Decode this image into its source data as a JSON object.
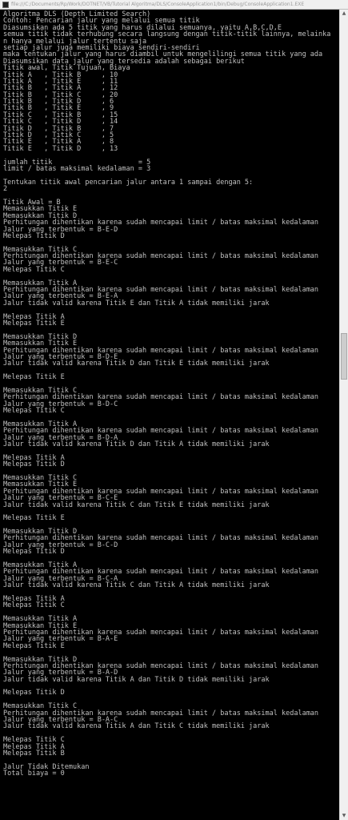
{
  "window": {
    "title": "file:///C:/Documents/Rp/Work/DOTNET/VB/Tutorial Algoritma/DLS/ConsoleApplication1/bin/Debug/ConsoleApplication1.EXE"
  },
  "scrollbar": {
    "up_icon": "▲",
    "down_icon": "▼"
  },
  "console": {
    "lines": [
      "Algoritma DLS (Depth Limited Search)",
      "Contoh: Pencarian jalur yang melalui semua titik",
      "Diasumsikan ada 5 titik yang harus dilalui semuanya, yaitu A,B,C,D,E",
      "semua titik tidak terhubung secara langsung dengan titik-titik lainnya, melainka",
      "n hanya melalui jalur tertentu saja",
      "setiap jalur juga memiliki biaya sendiri-sendiri",
      "maka tentukan jalur yang harus diambil untuk mengelilingi semua titik yang ada",
      "Diasumsikan data jalur yang tersedia adalah sebagai berikut",
      "Titik awal, Titik Tujuan, Biaya",
      "Titik A   , Titik B     , 10",
      "Titik A   , Titik E     , 11",
      "Titik B   , Titik A     , 12",
      "Titik B   , Titik C     , 20",
      "Titik B   , Titik D     , 6",
      "Titik B   , Titik E     , 9",
      "Titik C   , Titik B     , 15",
      "Titik C   , Titik D     , 14",
      "Titik D   , Titik B     , 7",
      "Titik D   , Titik C     , 5",
      "Titik E   , Titik A     , 8",
      "Titik E   , Titik D     , 13",
      "",
      "jumlah titik                     = 5",
      "limit / batas maksimal kedalaman = 3",
      "",
      "Tentukan titik awal pencarian jalur antara 1 sampai dengan 5:",
      "2",
      "",
      "Titik Awal = B",
      "Memasukkan Titik E",
      "Memasukkan Titik D",
      "Perhitungan dihentikan karena sudah mencapai limit / batas maksimal kedalaman",
      "Jalur yang terbentuk = B-E-D",
      "Melepas Titik D",
      "",
      "Memasukkan Titik C",
      "Perhitungan dihentikan karena sudah mencapai limit / batas maksimal kedalaman",
      "Jalur yang terbentuk = B-E-C",
      "Melepas Titik C",
      "",
      "Memasukkan Titik A",
      "Perhitungan dihentikan karena sudah mencapai limit / batas maksimal kedalaman",
      "Jalur yang terbentuk = B-E-A",
      "Jalur tidak valid karena Titik E dan Titik A tidak memiliki jarak",
      "",
      "Melepas Titik A",
      "Melepas Titik E",
      "",
      "Memasukkan Titik D",
      "Memasukkan Titik E",
      "Perhitungan dihentikan karena sudah mencapai limit / batas maksimal kedalaman",
      "Jalur yang terbentuk = B-D-E",
      "Jalur tidak valid karena Titik D dan Titik E tidak memiliki jarak",
      "",
      "Melepas Titik E",
      "",
      "Memasukkan Titik C",
      "Perhitungan dihentikan karena sudah mencapai limit / batas maksimal kedalaman",
      "Jalur yang terbentuk = B-D-C",
      "Melepas Titik C",
      "",
      "Memasukkan Titik A",
      "Perhitungan dihentikan karena sudah mencapai limit / batas maksimal kedalaman",
      "Jalur yang terbentuk = B-D-A",
      "Jalur tidak valid karena Titik D dan Titik A tidak memiliki jarak",
      "",
      "Melepas Titik A",
      "Melepas Titik D",
      "",
      "Memasukkan Titik C",
      "Memasukkan Titik E",
      "Perhitungan dihentikan karena sudah mencapai limit / batas maksimal kedalaman",
      "Jalur yang terbentuk = B-C-E",
      "Jalur tidak valid karena Titik C dan Titik E tidak memiliki jarak",
      "",
      "Melepas Titik E",
      "",
      "Memasukkan Titik D",
      "Perhitungan dihentikan karena sudah mencapai limit / batas maksimal kedalaman",
      "Jalur yang terbentuk = B-C-D",
      "Melepas Titik D",
      "",
      "Memasukkan Titik A",
      "Perhitungan dihentikan karena sudah mencapai limit / batas maksimal kedalaman",
      "Jalur yang terbentuk = B-C-A",
      "Jalur tidak valid karena Titik C dan Titik A tidak memiliki jarak",
      "",
      "Melepas Titik A",
      "Melepas Titik C",
      "",
      "Memasukkan Titik A",
      "Memasukkan Titik E",
      "Perhitungan dihentikan karena sudah mencapai limit / batas maksimal kedalaman",
      "Jalur yang terbentuk = B-A-E",
      "Melepas Titik E",
      "",
      "Memasukkan Titik D",
      "Perhitungan dihentikan karena sudah mencapai limit / batas maksimal kedalaman",
      "Jalur yang terbentuk = B-A-D",
      "Jalur tidak valid karena Titik A dan Titik D tidak memiliki jarak",
      "",
      "Melepas Titik D",
      "",
      "Memasukkan Titik C",
      "Perhitungan dihentikan karena sudah mencapai limit / batas maksimal kedalaman",
      "Jalur yang terbentuk = B-A-C",
      "Jalur tidak valid karena Titik A dan Titik C tidak memiliki jarak",
      "",
      "Melepas Titik C",
      "Melepas Titik A",
      "Melepas Titik B",
      "",
      "Jalur Tidak Ditemukan",
      "Total biaya = 0"
    ]
  }
}
